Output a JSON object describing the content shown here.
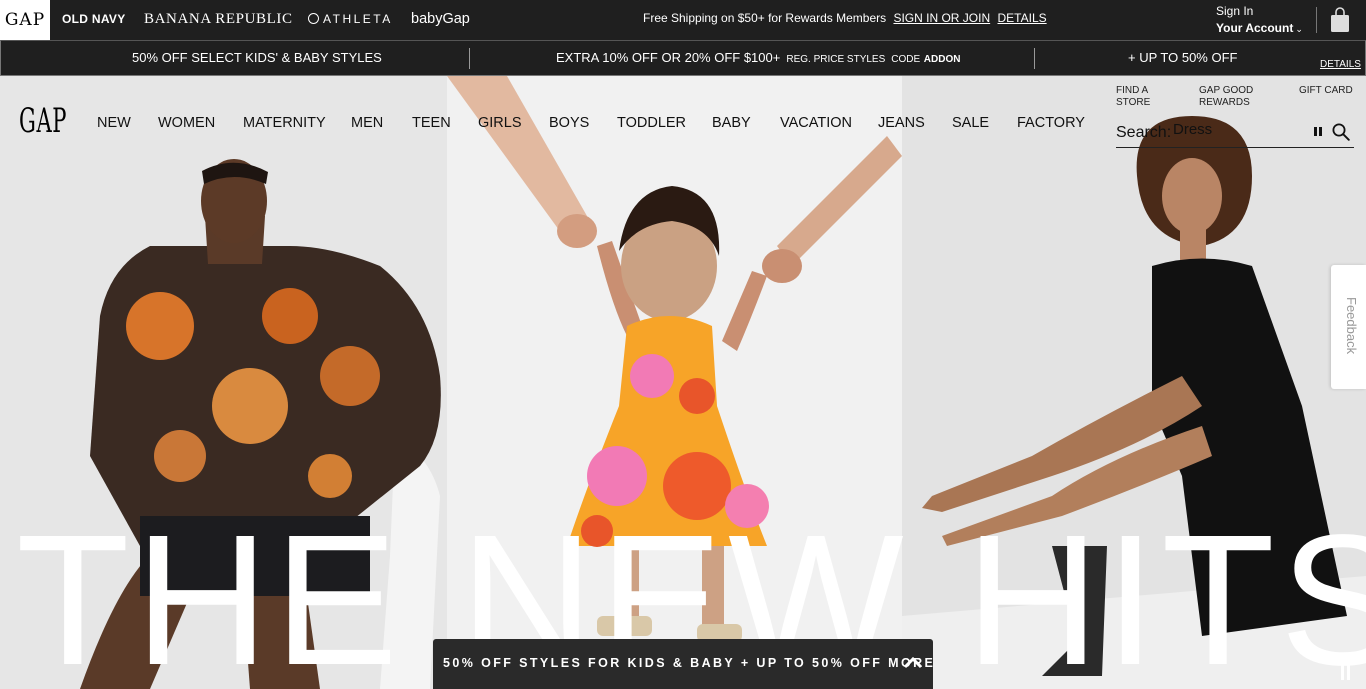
{
  "brand_bar": {
    "gap_logo": "GAP",
    "brands": [
      "OLD NAVY",
      "BANANA REPUBLIC",
      "ATHLETA",
      "babyGap"
    ],
    "shipping_text": "Free Shipping on $50+ for Rewards Members",
    "sign_in_join": "SIGN IN OR JOIN",
    "details": "DETAILS",
    "account_label": "Sign In",
    "account_button": "Your Account",
    "bag_icon": "shopping-bag-icon"
  },
  "promo_bar": {
    "promo_1": "50% OFF SELECT KIDS' & BABY STYLES",
    "promo_2_main": "EXTRA 10% OFF OR 20% OFF $100+",
    "promo_2_small": "REG. PRICE STYLES",
    "promo_2_code": "CODE",
    "promo_2_code_value": "ADDON",
    "promo_3": "+ UP TO 50% OFF",
    "details": "DETAILS"
  },
  "header": {
    "logo": "GAP",
    "nav": [
      "NEW",
      "WOMEN",
      "MATERNITY",
      "MEN",
      "TEEN",
      "GIRLS",
      "BOYS",
      "TODDLER",
      "BABY",
      "VACATION",
      "JEANS",
      "SALE",
      "FACTORY"
    ],
    "find_store": "FIND A STORE",
    "rewards": "GAP GOOD REWARDS",
    "gift_card": "GIFT CARD",
    "search_label": "Search:",
    "search_value": "Dress",
    "search_icon": "search-icon"
  },
  "hero": {
    "headline": "THE NEW HITS",
    "feedback": "Feedback"
  },
  "drawer": {
    "text": "50% OFF STYLES FOR KIDS & BABY + UP TO 50% OFF MORE",
    "icon": "chevron-up-icon"
  },
  "colors": {
    "bar_bg": "#1f1f1f",
    "headline": "#ffffff",
    "drawer_bg": "#2a2a2a"
  }
}
